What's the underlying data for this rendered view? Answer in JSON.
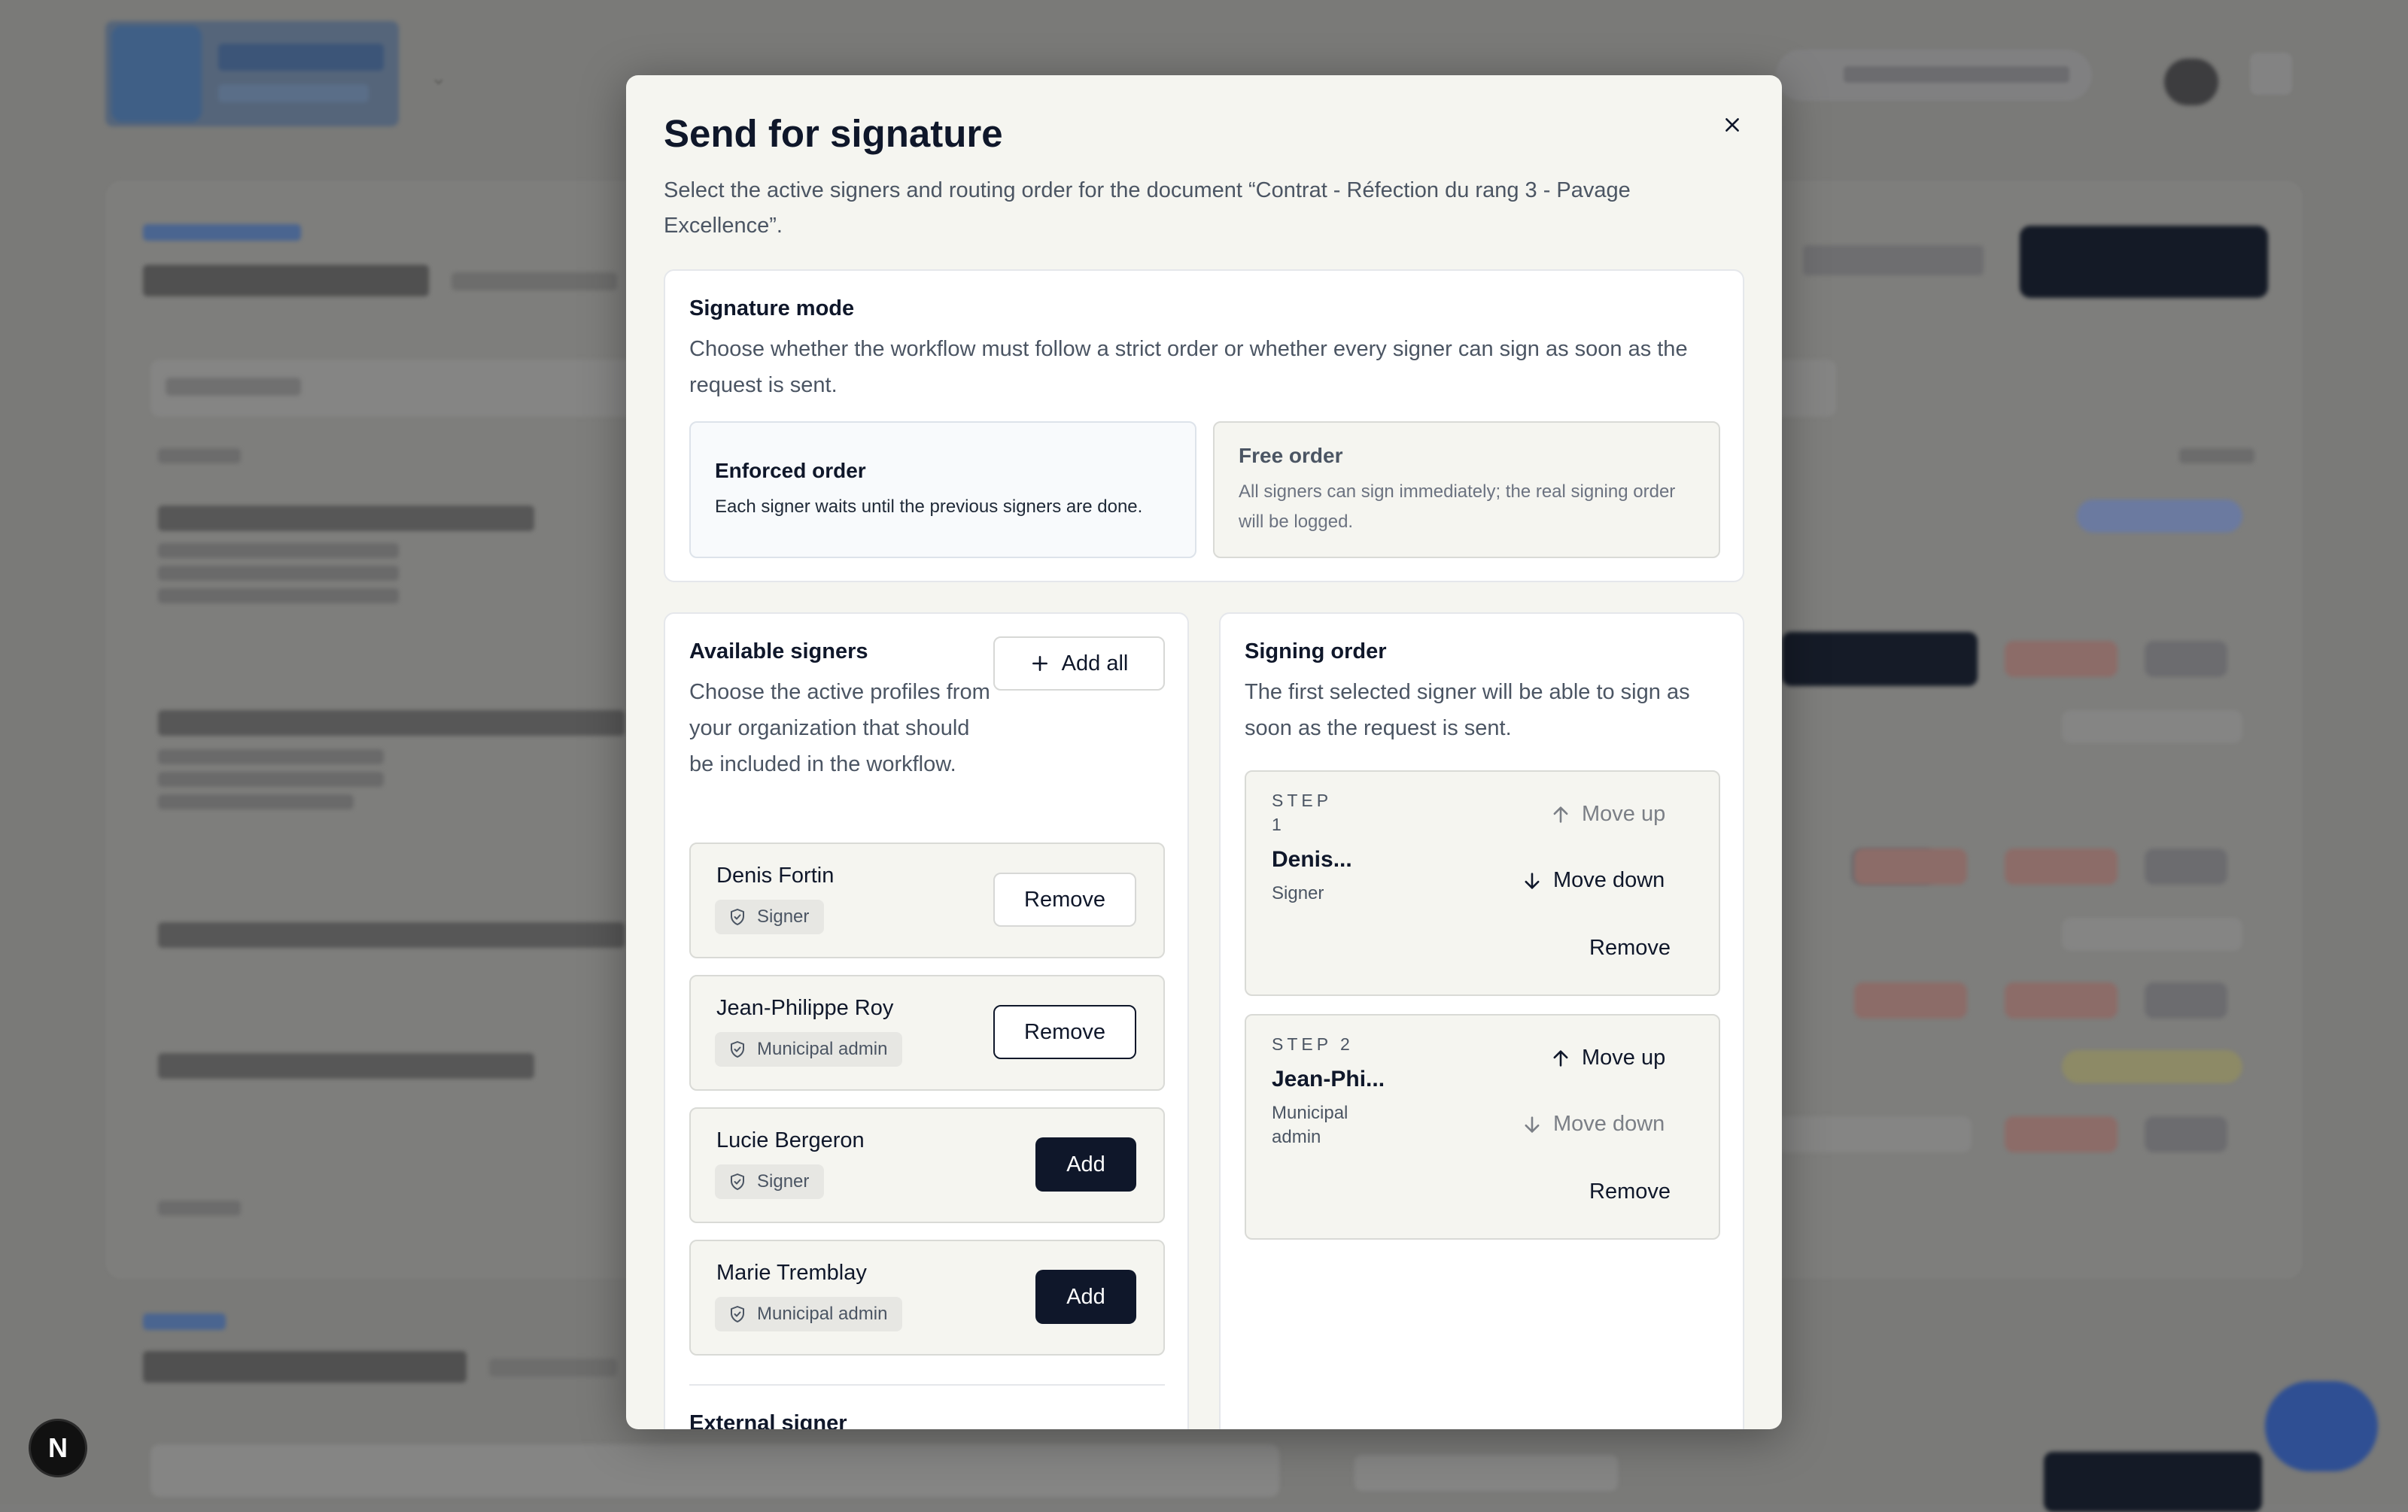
{
  "dev_badge": "N",
  "modal": {
    "title": "Send for signature",
    "description": "Select the active signers and routing order for the document “Contrat - Réfection du rang 3 - Pavage Excellence”.",
    "mode": {
      "title": "Signature mode",
      "description": "Choose whether the workflow must follow a strict order or whether every signer can sign as soon as the request is sent.",
      "options": [
        {
          "title": "Enforced order",
          "text": "Each signer waits until the previous signers are done.",
          "selected": true
        },
        {
          "title": "Free order",
          "text": "All signers can sign immediately; the real signing order will be logged.",
          "selected": false
        }
      ]
    },
    "available": {
      "title": "Available signers",
      "description": "Choose the active profiles from your organization that should be included in the workflow.",
      "add_all_label": "Add all",
      "signers": [
        {
          "name": "Denis Fortin",
          "role": "Signer",
          "action": "Remove"
        },
        {
          "name": "Jean-Philippe Roy",
          "role": "Municipal admin",
          "action": "Remove"
        },
        {
          "name": "Lucie Bergeron",
          "role": "Signer",
          "action": "Add"
        },
        {
          "name": "Marie Tremblay",
          "role": "Municipal admin",
          "action": "Add"
        }
      ],
      "external_title": "External signer"
    },
    "order": {
      "title": "Signing order",
      "description": "The first selected signer will be able to sign as soon as the request is sent.",
      "steps": [
        {
          "step_label_a": "STEP",
          "step_label_b": "1",
          "name": "Denis...",
          "role": "Signer",
          "move_up": "Move up",
          "move_down": "Move down",
          "remove": "Remove"
        },
        {
          "step_label": "STEP 2",
          "name": "Jean-Phi...",
          "role_a": "Municipal",
          "role_b": "admin",
          "move_up": "Move up",
          "move_down": "Move down",
          "remove": "Remove"
        }
      ]
    }
  }
}
